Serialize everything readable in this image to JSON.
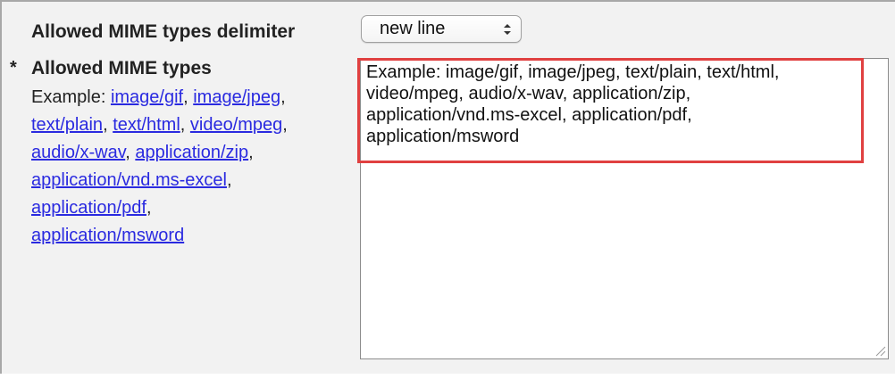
{
  "delimiter_row": {
    "label": "Allowed MIME types delimiter",
    "select_value": "new line"
  },
  "mime_field": {
    "required_marker": "*",
    "title": "Allowed MIME types",
    "help_prefix": "Example: ",
    "examples": [
      "image/gif",
      "image/jpeg",
      "text/plain",
      "text/html",
      "video/mpeg",
      "audio/x-wav",
      "application/zip",
      "application/vnd.ms-excel",
      "application/pdf",
      "application/msword"
    ],
    "separator": ",",
    "textarea_value": "Example: image/gif, image/jpeg, text/plain, text/html,\nvideo/mpeg, audio/x-wav, application/zip,\napplication/vnd.ms-excel, application/pdf,\napplication/msword"
  },
  "colors": {
    "highlight": "#e04040",
    "link": "#2a2ae0",
    "panel_background": "#f2f2f2"
  }
}
